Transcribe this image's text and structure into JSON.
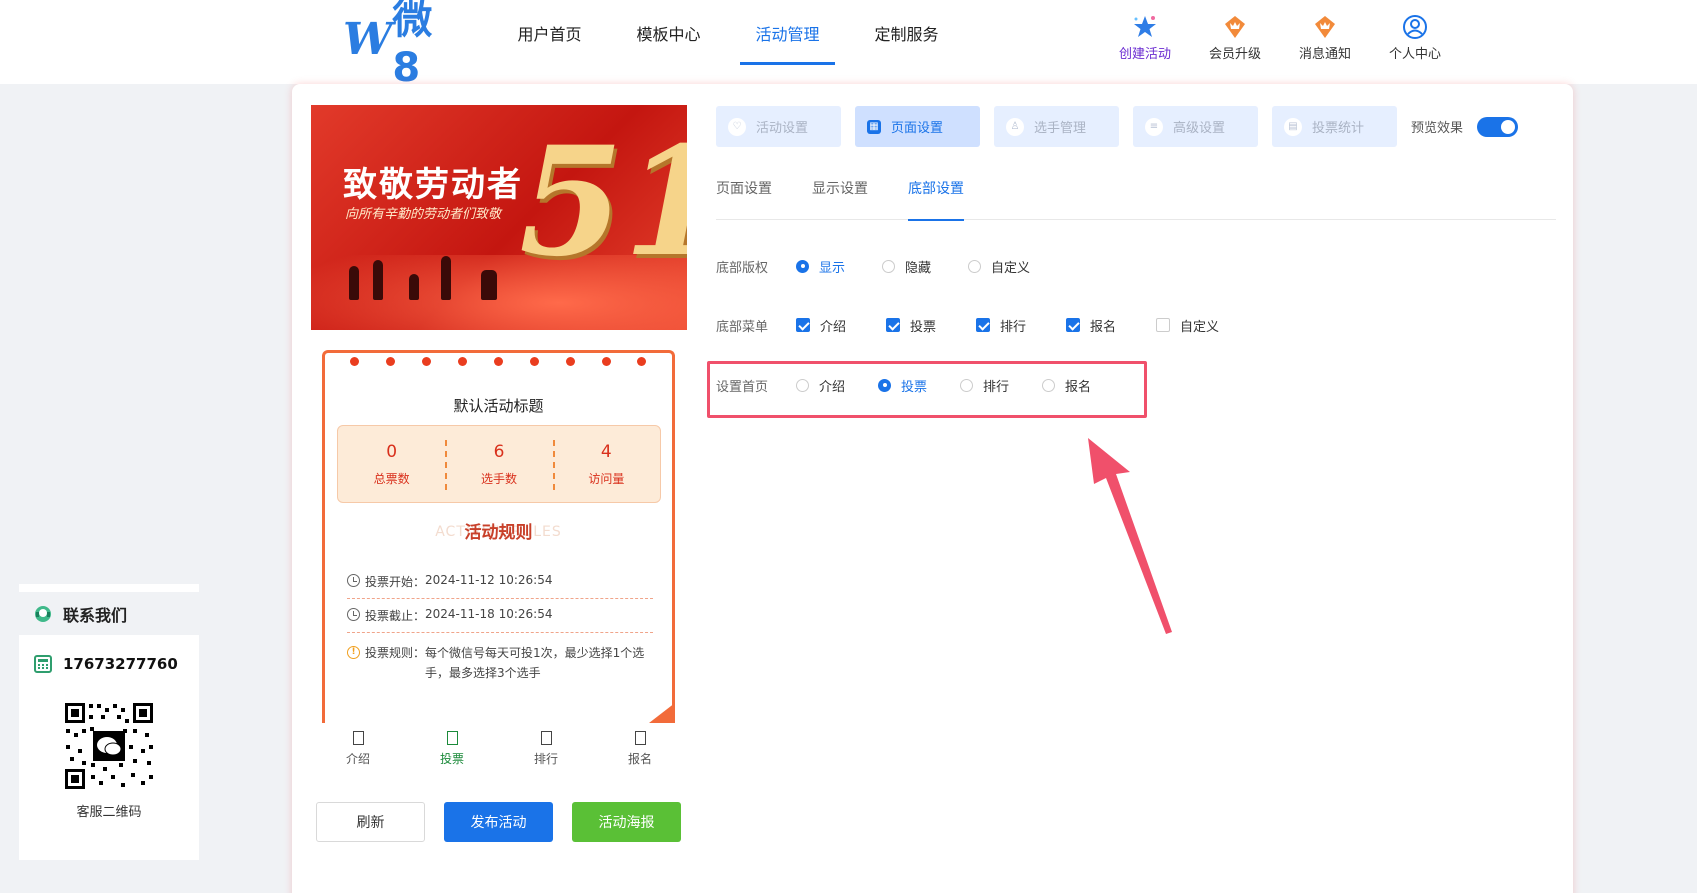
{
  "header": {
    "logo_text": "微8",
    "nav": [
      "用户首页",
      "模板中心",
      "活动管理",
      "定制服务"
    ],
    "nav_active": 2,
    "tools": [
      {
        "label": "创建活动",
        "icon": "star-icon"
      },
      {
        "label": "会员升级",
        "icon": "crown-icon"
      },
      {
        "label": "消息通知",
        "icon": "bell-crown-icon"
      },
      {
        "label": "个人中心",
        "icon": "user-icon"
      }
    ]
  },
  "preview": {
    "banner_title": "致敬劳动者",
    "banner_subtitle": "向所有辛勤的劳动者们致敬",
    "banner_number": "51",
    "activity_title": "默认活动标题",
    "stats": [
      {
        "value": "0",
        "label": "总票数"
      },
      {
        "value": "6",
        "label": "选手数"
      },
      {
        "value": "4",
        "label": "访问量"
      }
    ],
    "rules_title": "活动规则",
    "rules_bg": "ACTIVITY RULES",
    "rules": [
      {
        "label": "投票开始：",
        "value": "2024-11-12 10:26:54"
      },
      {
        "label": "投票截止：",
        "value": "2024-11-18 10:26:54"
      },
      {
        "label": "投票规则：",
        "value": "每个微信号每天可投1次，最少选择1个选手，最多选择3个选手"
      }
    ],
    "bottom_nav": [
      "介绍",
      "投票",
      "排行",
      "报名"
    ],
    "bottom_nav_active": 1,
    "buttons": {
      "refresh": "刷新",
      "publish": "发布活动",
      "poster": "活动海报"
    }
  },
  "settings": {
    "tabs": [
      "活动设置",
      "页面设置",
      "选手管理",
      "高级设置",
      "投票统计"
    ],
    "tab_active": 1,
    "preview_label": "预览效果",
    "subtabs": [
      "页面设置",
      "显示设置",
      "底部设置"
    ],
    "subtab_active": 2,
    "copyright": {
      "label": "底部版权",
      "options": [
        "显示",
        "隐藏",
        "自定义"
      ],
      "selected": 0
    },
    "menu": {
      "label": "底部菜单",
      "options": [
        "介绍",
        "投票",
        "排行",
        "报名",
        "自定义"
      ],
      "checked": [
        true,
        true,
        true,
        true,
        false
      ]
    },
    "home": {
      "label": "设置首页",
      "options": [
        "介绍",
        "投票",
        "排行",
        "报名"
      ],
      "selected": 1
    }
  },
  "contact": {
    "title": "联系我们",
    "phone": "17673277760",
    "qr_label": "客服二维码"
  },
  "colors": {
    "primary": "#1a73e8",
    "green": "#5ac036",
    "highlight": "#f0506b"
  }
}
